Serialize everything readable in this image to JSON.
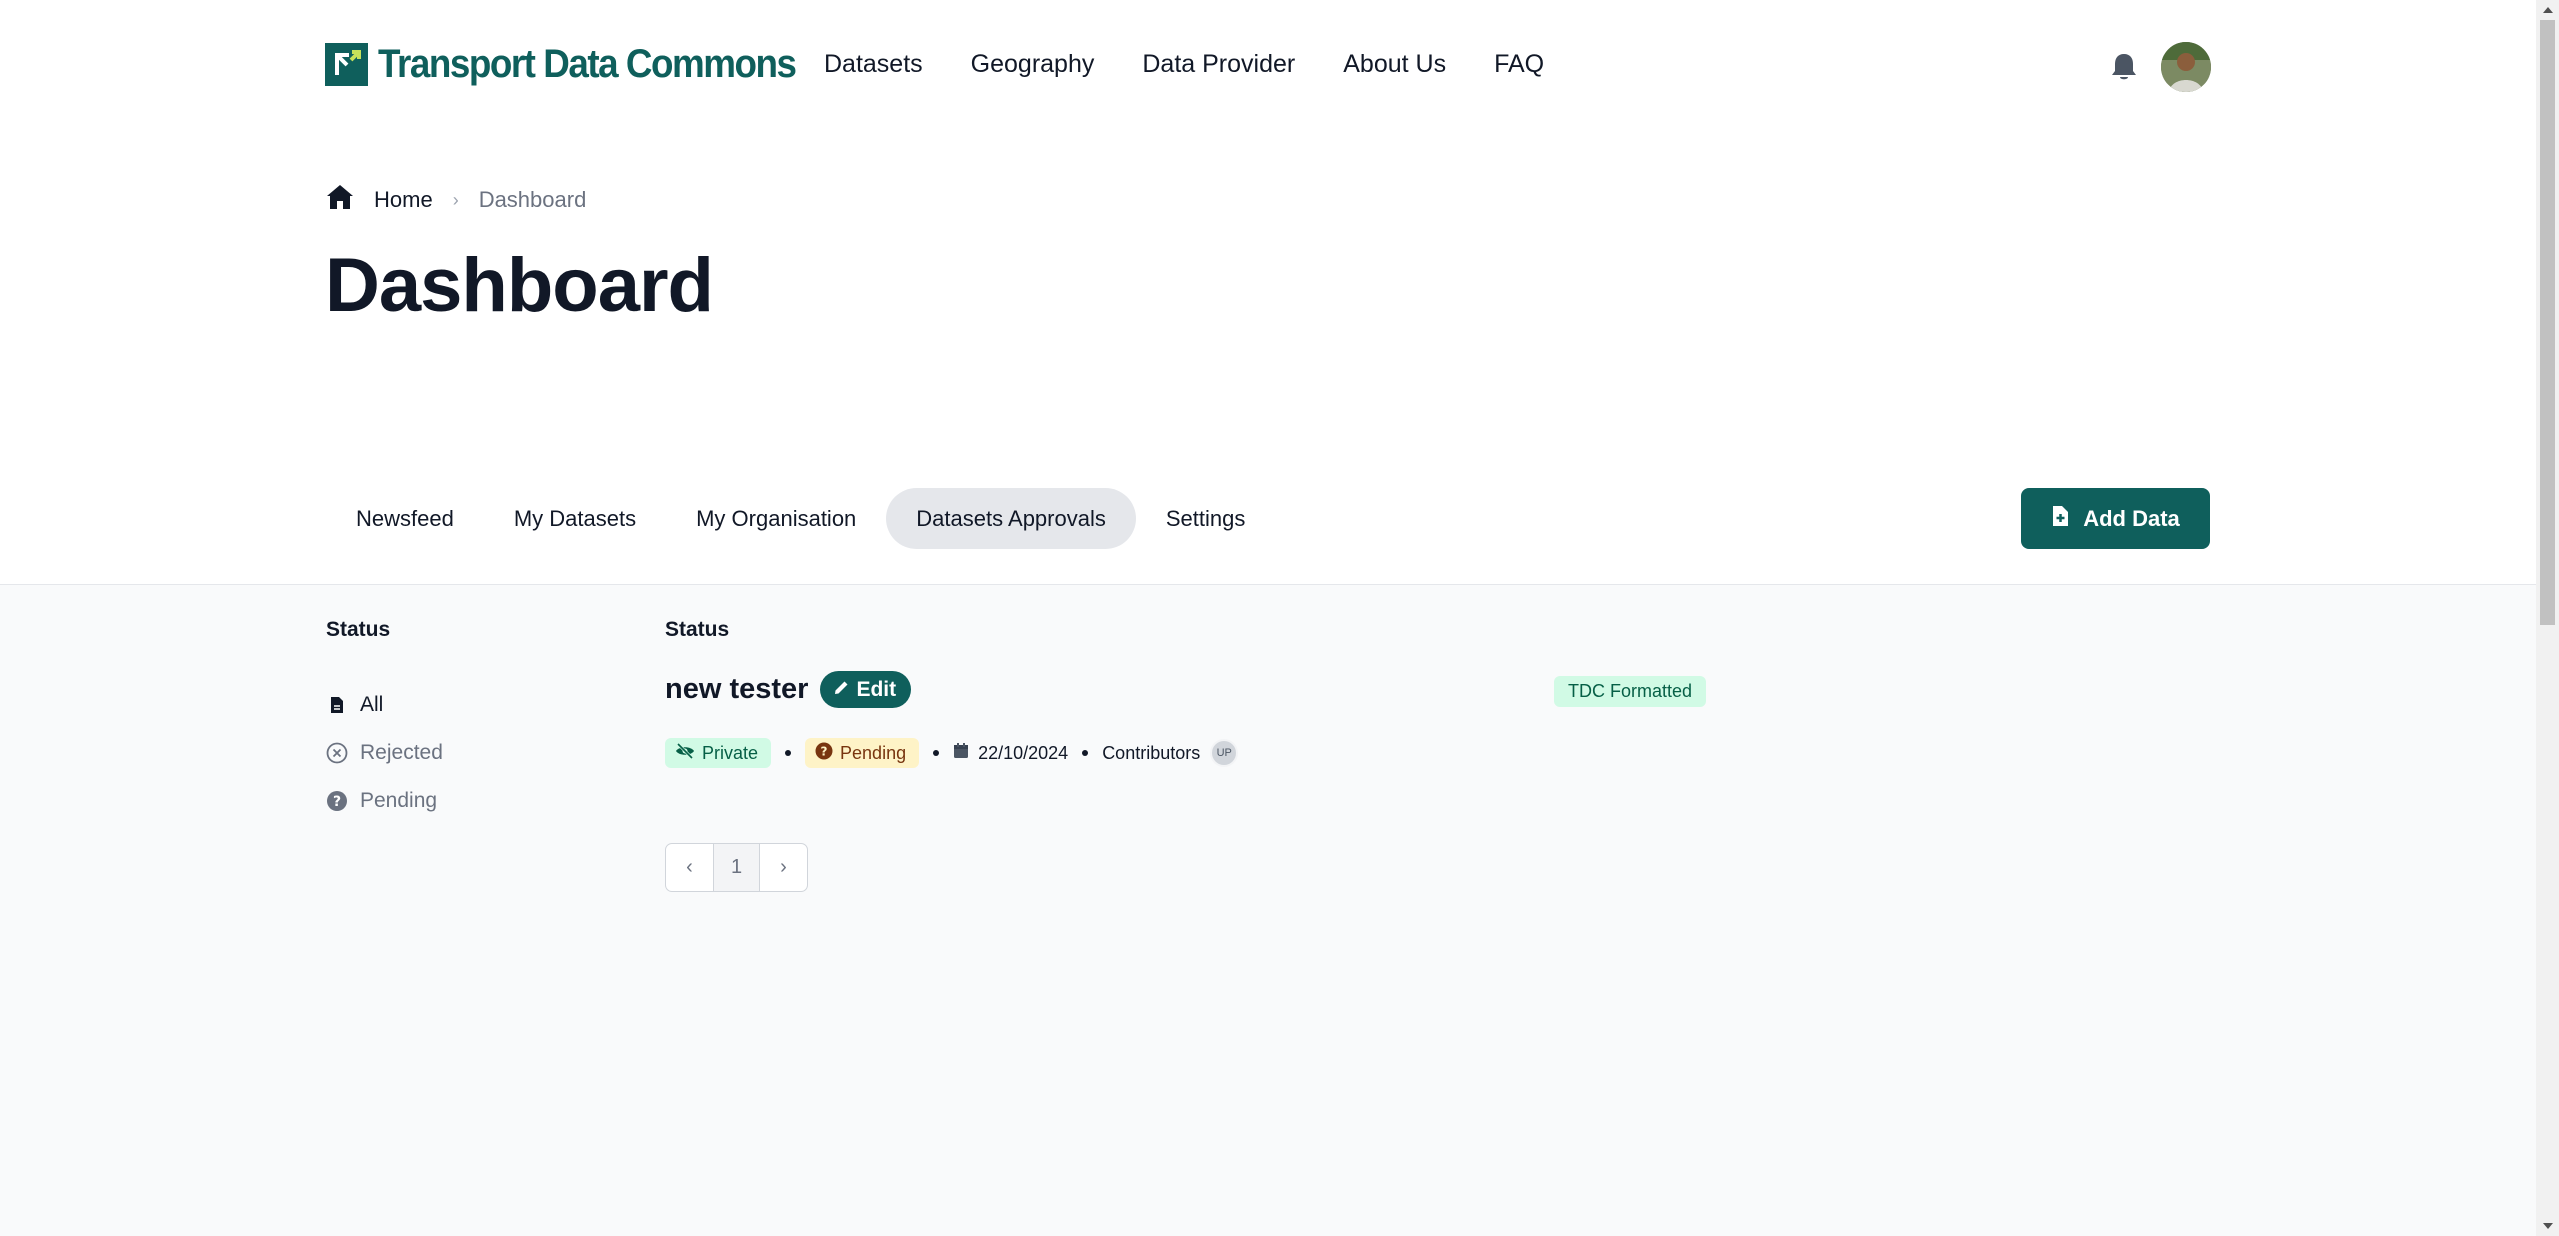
{
  "header": {
    "logo_text": "Transport Data Commons",
    "nav": [
      {
        "label": "Datasets"
      },
      {
        "label": "Geography"
      },
      {
        "label": "Data Provider"
      },
      {
        "label": "About Us"
      },
      {
        "label": "FAQ"
      }
    ],
    "icons": {
      "notifications": "bell-icon",
      "user": "avatar"
    }
  },
  "breadcrumb": {
    "home": "Home",
    "current": "Dashboard"
  },
  "page_title": "Dashboard",
  "tabs": [
    {
      "label": "Newsfeed",
      "active": false
    },
    {
      "label": "My Datasets",
      "active": false
    },
    {
      "label": "My Organisation",
      "active": false
    },
    {
      "label": "Datasets Approvals",
      "active": true
    },
    {
      "label": "Settings",
      "active": false
    }
  ],
  "add_data_label": "Add Data",
  "sidebar": {
    "title": "Status",
    "items": [
      {
        "label": "All",
        "icon": "file-icon",
        "active": true
      },
      {
        "label": "Rejected",
        "icon": "x-circle-icon",
        "active": false
      },
      {
        "label": "Pending",
        "icon": "question-circle-icon",
        "active": false
      }
    ]
  },
  "results": {
    "title": "Status",
    "dataset": {
      "name": "new tester",
      "edit_label": "Edit",
      "format_badge": "TDC Formatted",
      "visibility": "Private",
      "status": "Pending",
      "date": "22/10/2024",
      "contributors_label": "Contributors",
      "contributor_initials": "UP"
    },
    "pagination": {
      "prev": "‹",
      "current_page": "1",
      "next": "›"
    }
  },
  "colors": {
    "brand": "#0f5f5c",
    "tab_active_bg": "#e5e7eb",
    "private_bg": "#d1fae5",
    "pending_bg": "#fef3c7",
    "content_bg": "#f9fafb"
  }
}
